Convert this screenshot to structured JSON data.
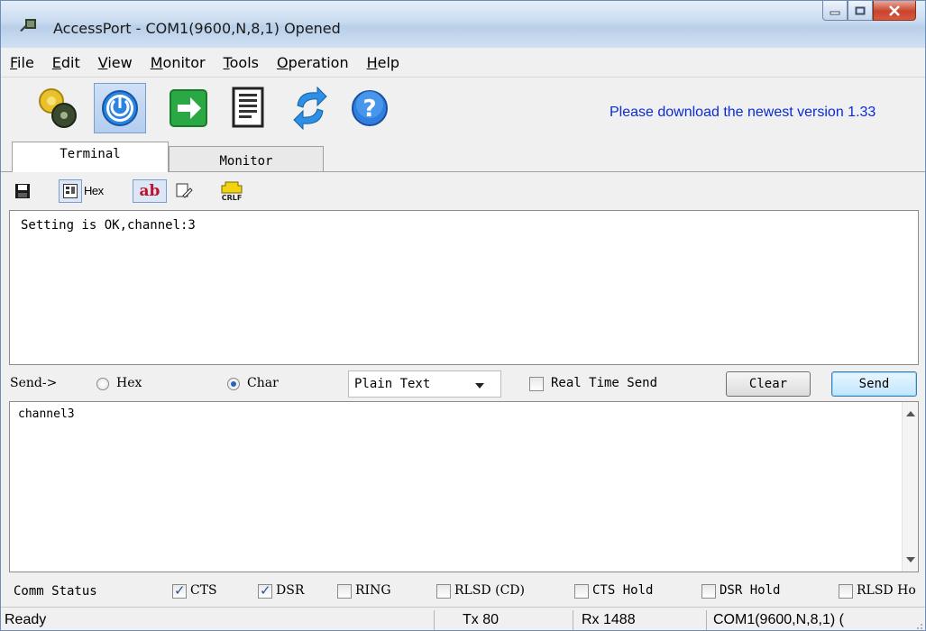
{
  "window": {
    "title": "AccessPort - COM1(9600,N,8,1) Opened"
  },
  "menu": [
    {
      "label": "File",
      "key": "F",
      "rest": "ile"
    },
    {
      "label": "Edit",
      "key": "E",
      "rest": "dit"
    },
    {
      "label": "View",
      "key": "V",
      "rest": "iew"
    },
    {
      "label": "Monitor",
      "key": "M",
      "rest": "onitor"
    },
    {
      "label": "Tools",
      "key": "T",
      "rest": "ools"
    },
    {
      "label": "Operation",
      "key": "O",
      "rest": "peration"
    },
    {
      "label": "Help",
      "key": "H",
      "rest": "elp"
    }
  ],
  "toolbar": {
    "update_notice": "Please download the newest version 1.33"
  },
  "tabs": {
    "terminal": "Terminal",
    "monitor": "Monitor"
  },
  "term_toolbar": {
    "hex_label": "Hex",
    "ab_label": "ab",
    "crlf_label": "CRLF"
  },
  "receive": {
    "text": "Setting is OK,channel:3"
  },
  "send_bar": {
    "label": "Send->",
    "hex_label": "Hex",
    "char_label": "Char",
    "mode": "char",
    "format_selected": "Plain Text",
    "realtime_label": "Real Time Send",
    "realtime_checked": false,
    "clear_label": "Clear",
    "send_label": "Send"
  },
  "send_area": {
    "text": "channel3"
  },
  "comm_status": {
    "label": "Comm Status",
    "items": [
      {
        "label": "CTS",
        "checked": true
      },
      {
        "label": "DSR",
        "checked": true
      },
      {
        "label": "RING",
        "checked": false
      },
      {
        "label": "RLSD (CD)",
        "checked": false
      },
      {
        "label": "CTS Hold",
        "checked": false
      },
      {
        "label": "DSR Hold",
        "checked": false
      },
      {
        "label": "RLSD Ho",
        "checked": false
      }
    ]
  },
  "status_bar": {
    "state": "Ready",
    "tx": "Tx 80",
    "rx": "Rx 1488",
    "port": "COM1(9600,N,8,1) ("
  }
}
